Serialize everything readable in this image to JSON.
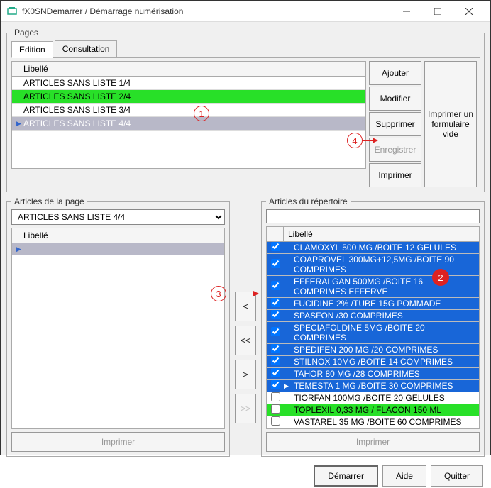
{
  "window": {
    "title": "fX0SNDemarrer / Démarrage numérisation"
  },
  "pagesGroup": {
    "legend": "Pages",
    "tabs": {
      "edition": "Edition",
      "consultation": "Consultation"
    },
    "libelleHeader": "Libellé",
    "rows": [
      {
        "label": "ARTICLES SANS LISTE 1/4",
        "style": "white"
      },
      {
        "label": "ARTICLES SANS LISTE 2/4",
        "style": "green"
      },
      {
        "label": "ARTICLES SANS LISTE 3/4",
        "style": "white"
      },
      {
        "label": "ARTICLES SANS LISTE 4/4",
        "style": "selected",
        "current": true
      }
    ],
    "buttons": {
      "ajouter": "Ajouter",
      "modifier": "Modifier",
      "supprimer": "Supprimer",
      "enregistrer": "Enregistrer",
      "imprimer": "Imprimer",
      "imprimerFormVide": "Imprimer un formulaire vide"
    }
  },
  "articlesPage": {
    "legend": "Articles de la page",
    "comboValue": "ARTICLES SANS LISTE 4/4",
    "libelleHeader": "Libellé",
    "imprimer": "Imprimer"
  },
  "transfer": {
    "lt": "<",
    "ltlt": "<<",
    "gt": ">",
    "gtgt": ">>"
  },
  "articlesRepo": {
    "legend": "Articles du répertoire",
    "filter": "",
    "libelleHeader": "Libellé",
    "rows": [
      {
        "checked": true,
        "label": "CLAMOXYL 500 MG /BOITE 12 GELULES",
        "style": "blue"
      },
      {
        "checked": true,
        "label": "COAPROVEL 300MG+12,5MG /BOITE 90 COMPRIMES",
        "style": "blue"
      },
      {
        "checked": true,
        "label": "EFFERALGAN 500MG /BOITE 16 COMPRIMES EFFERVE",
        "style": "blue"
      },
      {
        "checked": true,
        "label": "FUCIDINE 2% /TUBE 15G POMMADE",
        "style": "blue"
      },
      {
        "checked": true,
        "label": "SPASFON /30 COMPRIMES",
        "style": "blue"
      },
      {
        "checked": true,
        "label": "SPECIAFOLDINE 5MG /BOITE 20 COMPRIMES",
        "style": "blue"
      },
      {
        "checked": true,
        "label": "SPEDIFEN 200 MG /20 COMPRIMES",
        "style": "blue"
      },
      {
        "checked": true,
        "label": "STILNOX 10MG /BOITE 14 COMPRIMES",
        "style": "blue"
      },
      {
        "checked": true,
        "label": "TAHOR 80 MG /28 COMPRIMES",
        "style": "blue"
      },
      {
        "checked": true,
        "label": "TEMESTA 1 MG /BOITE 30 COMPRIMES",
        "style": "blue",
        "current": true
      },
      {
        "checked": false,
        "label": "TIORFAN 100MG /BOITE 20 GELULES",
        "style": "white"
      },
      {
        "checked": false,
        "label": "TOPLEXIL 0,33 MG / FLACON 150 ML",
        "style": "green"
      },
      {
        "checked": false,
        "label": "VASTAREL 35 MG /BOITE 60 COMPRIMES",
        "style": "white"
      }
    ],
    "imprimer": "Imprimer"
  },
  "bottom": {
    "demarrer": "Démarrer",
    "aide": "Aide",
    "quitter": "Quitter"
  },
  "annotations": {
    "a1": "1",
    "a2": "2",
    "a3": "3",
    "a4": "4"
  }
}
